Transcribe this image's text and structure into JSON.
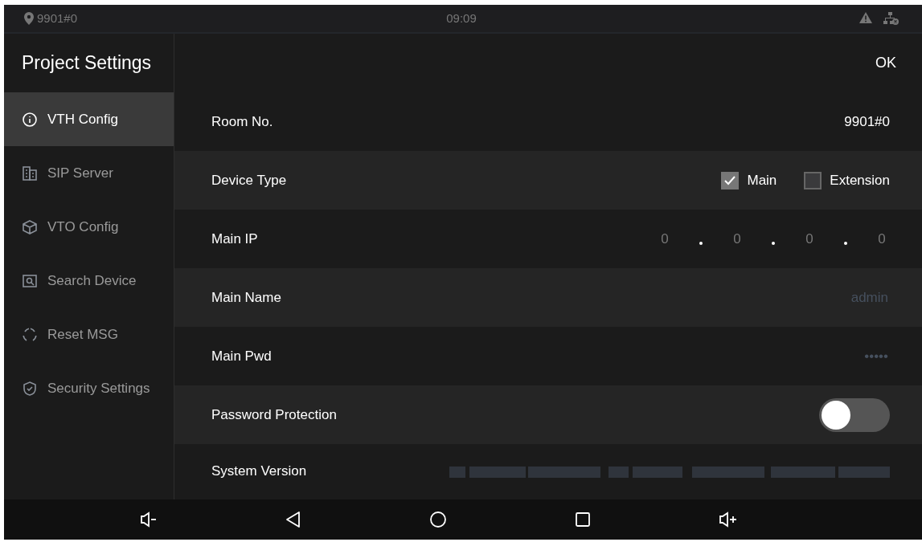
{
  "status_bar": {
    "location": "9901#0",
    "time": "09:09"
  },
  "header": {
    "title": "Project Settings",
    "ok_button": "OK"
  },
  "sidebar": {
    "items": [
      {
        "label": "VTH Config",
        "kind": "info",
        "selected": true
      },
      {
        "label": "SIP Server",
        "kind": "building",
        "selected": false
      },
      {
        "label": "VTO Config",
        "kind": "cube",
        "selected": false
      },
      {
        "label": "Search Device",
        "kind": "search",
        "selected": false
      },
      {
        "label": "Reset MSG",
        "kind": "reset",
        "selected": false
      },
      {
        "label": "Security Settings",
        "kind": "shield",
        "selected": false
      }
    ]
  },
  "rows": [
    {
      "kind": "text",
      "label": "Room No.",
      "value": "9901#0"
    },
    {
      "kind": "checkboxes",
      "label": "Device Type",
      "options": [
        {
          "label": "Main",
          "checked": true
        },
        {
          "label": "Extension",
          "checked": false
        }
      ]
    },
    {
      "kind": "ip",
      "label": "Main IP",
      "octets": [
        "0",
        "0",
        "0",
        "0"
      ]
    },
    {
      "kind": "field",
      "label": "Main Name",
      "placeholder": "admin"
    },
    {
      "kind": "field",
      "label": "Main Pwd",
      "placeholder": "•••••"
    },
    {
      "kind": "toggle",
      "label": "Password Protection",
      "on": false
    },
    {
      "kind": "blurred",
      "label": "System Version"
    }
  ]
}
